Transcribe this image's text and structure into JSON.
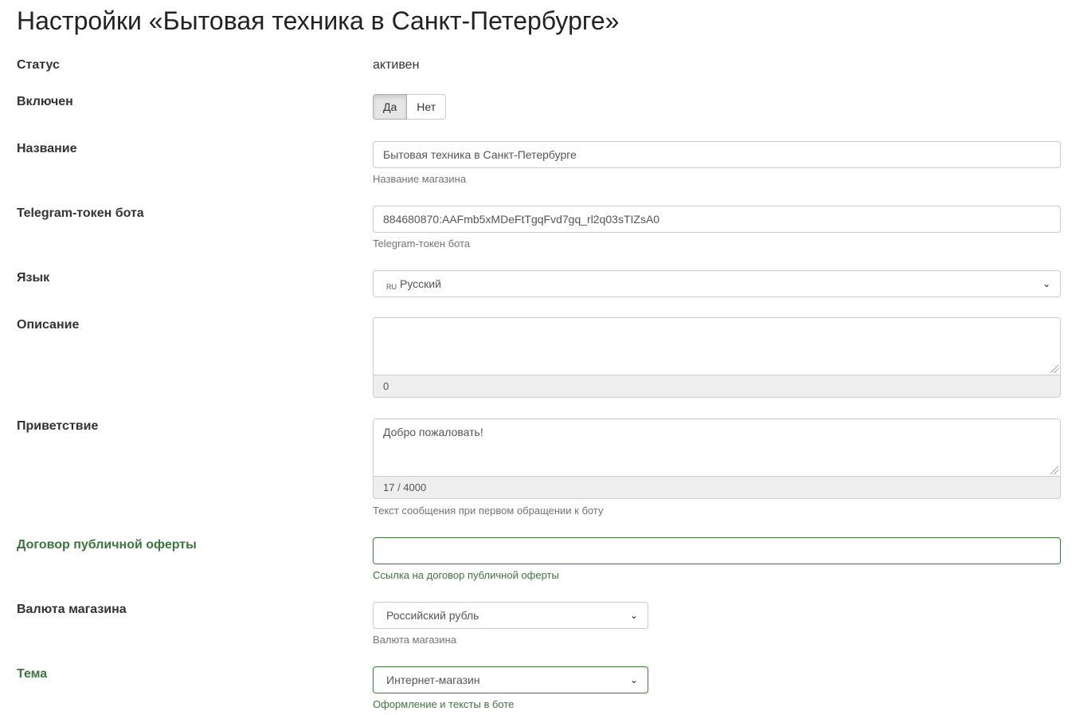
{
  "page": {
    "title": "Настройки «Бытовая техника в Санкт-Петербурге»"
  },
  "fields": {
    "status": {
      "label": "Статус",
      "value": "активен"
    },
    "enabled": {
      "label": "Включен",
      "yes": "Да",
      "no": "Нет",
      "selected": "Да"
    },
    "name": {
      "label": "Название",
      "value": "Бытовая техника в Санкт-Петербурге",
      "help": "Название магазина"
    },
    "token": {
      "label": "Telegram-токен бота",
      "value": "884680870:AAFmb5xMDeFtTgqFvd7gq_rl2q03sTIZsA0",
      "help": "Telegram-токен бота"
    },
    "language": {
      "label": "Язык",
      "flag": "RU",
      "value": "Русский"
    },
    "description": {
      "label": "Описание",
      "value": "",
      "counter": "0"
    },
    "greeting": {
      "label": "Приветствие",
      "value": "Добро пожаловать!",
      "counter": "17 / 4000",
      "help": "Текст сообщения при первом обращении к боту"
    },
    "offer": {
      "label": "Договор публичной оферты",
      "value": "",
      "help": "Ссылка на договор публичной оферты"
    },
    "currency": {
      "label": "Валюта магазина",
      "value": "Российский рубль",
      "help": "Валюта магазина"
    },
    "theme": {
      "label": "Тема",
      "value": "Интернет-магазин",
      "help": "Оформление и тексты в боте"
    }
  },
  "colors": {
    "success": "#3c763d",
    "border": "#cccccc",
    "counter_bg": "#eeeeee"
  }
}
